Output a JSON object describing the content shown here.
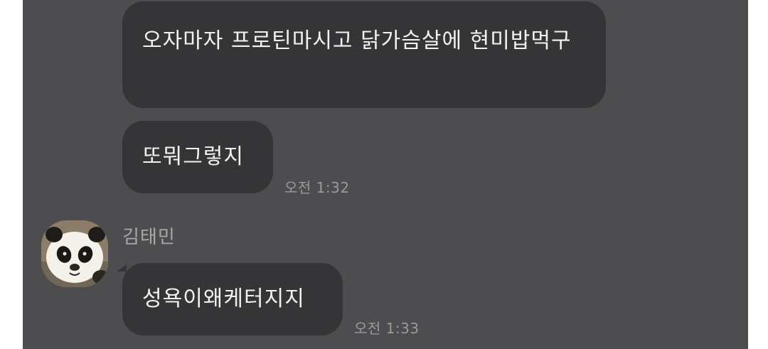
{
  "chat": {
    "messages": [
      {
        "text": "오자마자 프로틴마시고 닭가슴살에 현미밥먹구",
        "time": ""
      },
      {
        "text": "또뭐그렇지",
        "time": "오전 1:32"
      }
    ],
    "incoming": {
      "sender_name": "김태민",
      "avatar_icon": "panda-avatar-icon",
      "text": "성욕이왜케터지지",
      "time": "오전 1:33"
    }
  },
  "colors": {
    "background": "#4d4d4f",
    "bubble": "#353537",
    "text": "#f2f2f2",
    "timestamp": "#9a9a9c"
  }
}
